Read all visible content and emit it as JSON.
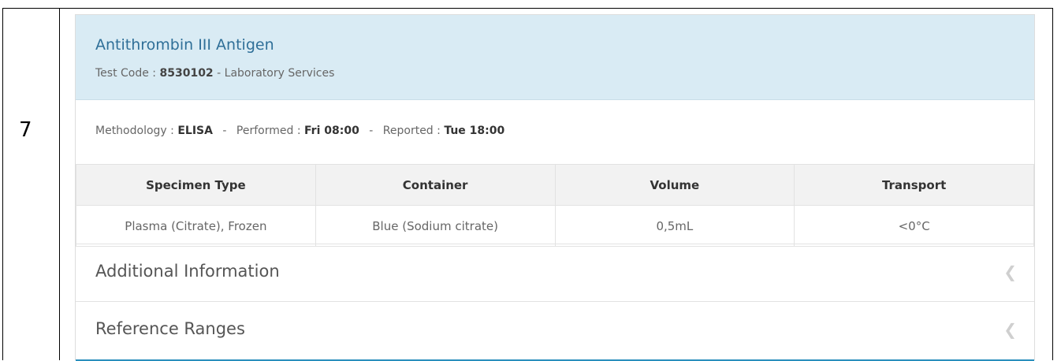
{
  "row_number": "7",
  "test": {
    "name": "Antithrombin III Antigen",
    "code_label": "Test Code : ",
    "code": "8530102",
    "dept": " - Laboratory Services"
  },
  "details": {
    "methodology_label": "Methodology : ",
    "methodology": "ELISA",
    "performed_label": "Performed : ",
    "performed": "Fri 08:00",
    "reported_label": "Reported : ",
    "reported": "Tue 18:00",
    "separator": "-"
  },
  "table": {
    "headers": [
      "Specimen Type",
      "Container",
      "Volume",
      "Transport"
    ],
    "row": [
      "Plasma (Citrate), Frozen",
      "Blue (Sodium citrate)",
      "0,5mL",
      "<0°C"
    ]
  },
  "accordion": {
    "additional": "Additional Information",
    "reference": "Reference Ranges",
    "icon": "chevron-left-icon"
  }
}
